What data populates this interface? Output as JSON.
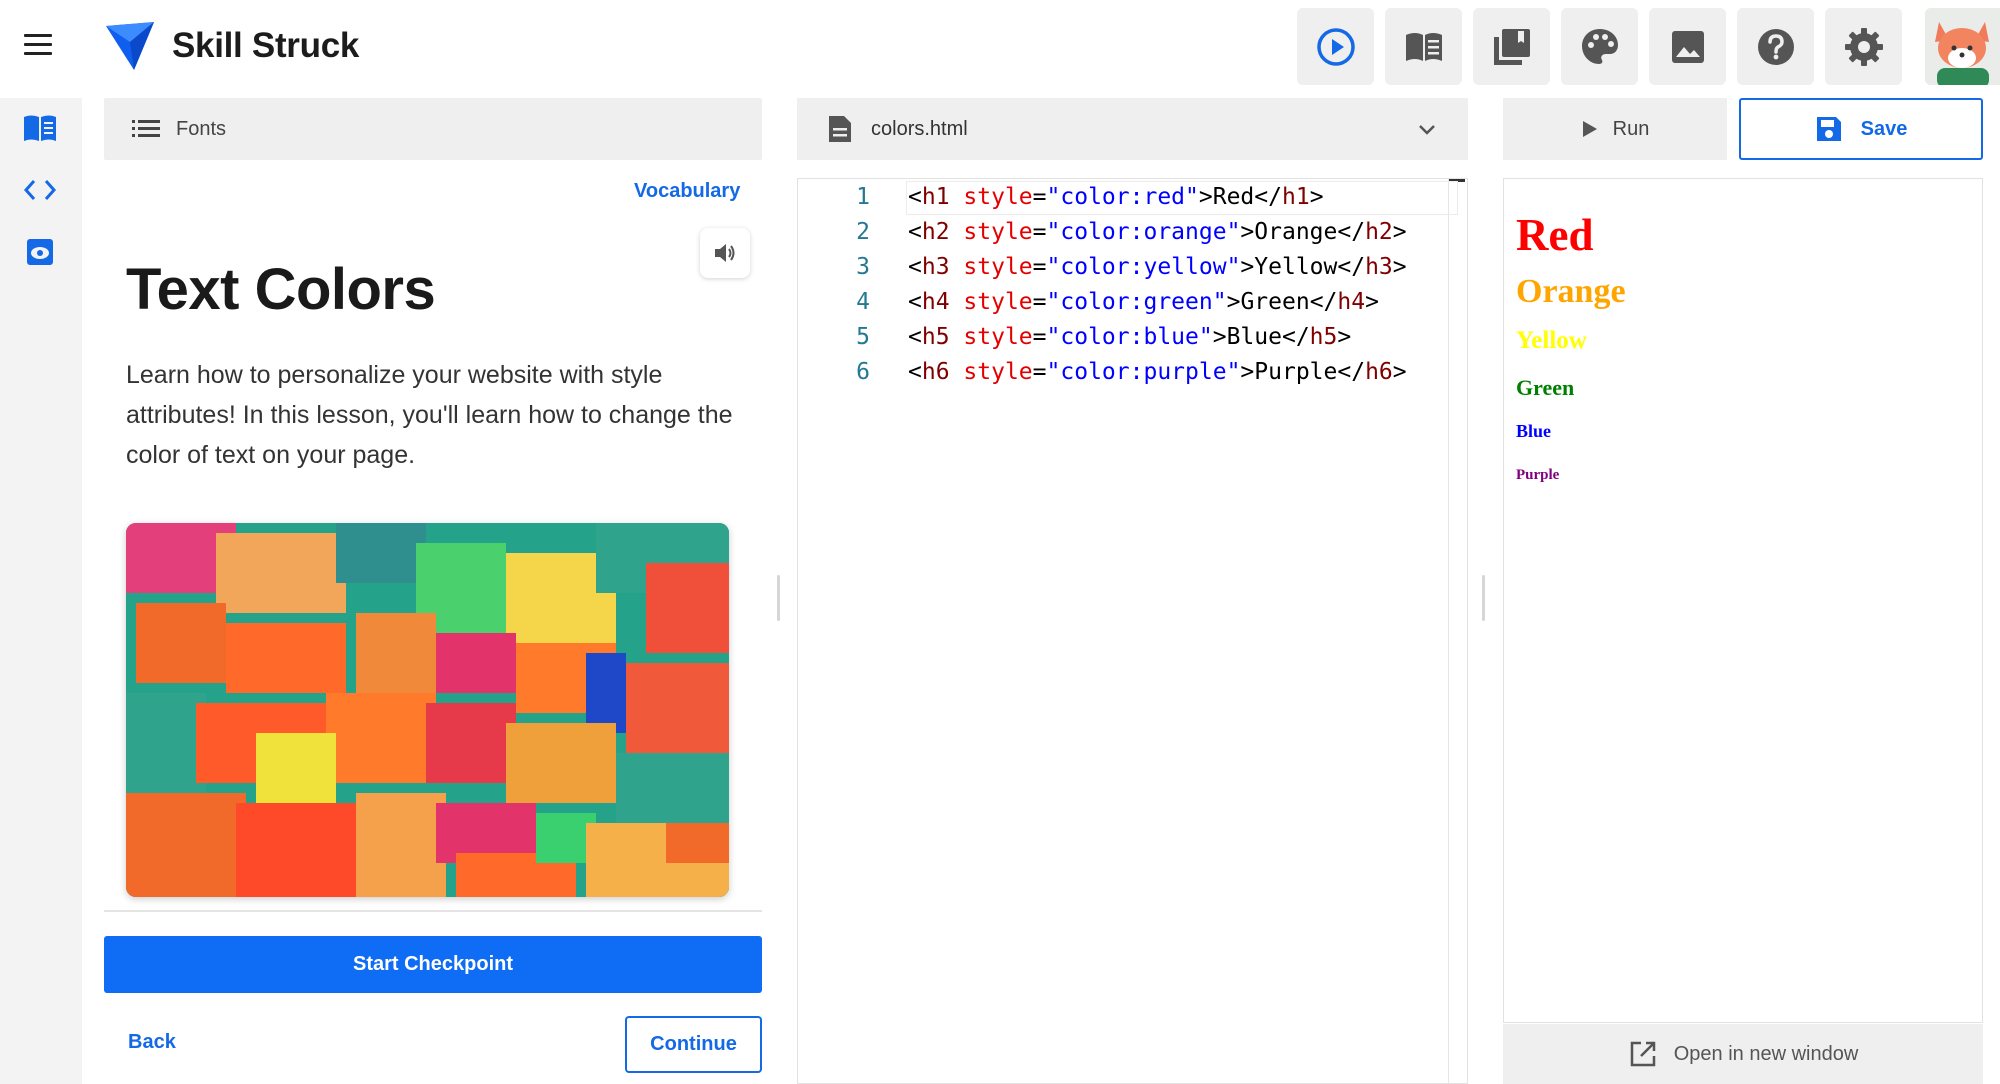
{
  "app": {
    "brand_name": "Skill Struck"
  },
  "toolbar": {
    "buttons": [
      {
        "icon": "play-circle-icon"
      },
      {
        "icon": "book-icon"
      },
      {
        "icon": "library-icon"
      },
      {
        "icon": "palette-icon"
      },
      {
        "icon": "image-icon"
      },
      {
        "icon": "help-icon"
      },
      {
        "icon": "settings-icon"
      }
    ],
    "avatar": "fox-avatar"
  },
  "rail": {
    "items": [
      {
        "icon": "lesson-book-icon"
      },
      {
        "icon": "code-icon"
      },
      {
        "icon": "preview-eye-icon"
      }
    ]
  },
  "lesson": {
    "section_label": "Fonts",
    "vocabulary_label": "Vocabulary",
    "title": "Text Colors",
    "description": "Learn how to personalize your website with style attributes! In this lesson, you'll learn how to change the color of text on your page.",
    "checkpoint_label": "Start Checkpoint",
    "back_label": "Back",
    "continue_label": "Continue"
  },
  "editor": {
    "file_name": "colors.html",
    "lines": [
      {
        "num": "1",
        "tag": "h1",
        "value": "red",
        "text": "Red"
      },
      {
        "num": "2",
        "tag": "h2",
        "value": "orange",
        "text": "Orange"
      },
      {
        "num": "3",
        "tag": "h3",
        "value": "yellow",
        "text": "Yellow"
      },
      {
        "num": "4",
        "tag": "h4",
        "value": "green",
        "text": "Green"
      },
      {
        "num": "5",
        "tag": "h5",
        "value": "blue",
        "text": "Blue"
      },
      {
        "num": "6",
        "tag": "h6",
        "value": "purple",
        "text": "Purple"
      }
    ]
  },
  "preview": {
    "run_label": "Run",
    "save_label": "Save",
    "open_window_label": "Open in new window",
    "headings": [
      {
        "text": "Red",
        "color": "#ff0000"
      },
      {
        "text": "Orange",
        "color": "#ffa500"
      },
      {
        "text": "Yellow",
        "color": "#ffff00"
      },
      {
        "text": "Green",
        "color": "#008000"
      },
      {
        "text": "Blue",
        "color": "#0000ff"
      },
      {
        "text": "Purple",
        "color": "#800080"
      }
    ]
  },
  "colors": {
    "accent": "#1469e6",
    "primary_button": "#0f6cf5",
    "panel_bg": "#efefef"
  }
}
